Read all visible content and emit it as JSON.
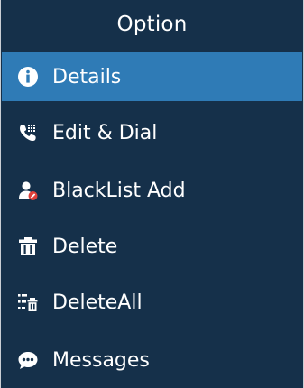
{
  "menu": {
    "title": "Option",
    "items": [
      {
        "label": "Details",
        "icon": "info-icon",
        "selected": true
      },
      {
        "label": "Edit & Dial",
        "icon": "phone-dialpad-icon",
        "selected": false
      },
      {
        "label": "BlackList Add",
        "icon": "user-block-icon",
        "selected": false
      },
      {
        "label": "Delete",
        "icon": "trash-icon",
        "selected": false
      },
      {
        "label": "DeleteAll",
        "icon": "delete-all-icon",
        "selected": false
      },
      {
        "label": "Messages",
        "icon": "chat-bubble-icon",
        "selected": false
      }
    ]
  },
  "colors": {
    "background": "#15304a",
    "selected": "#2f7bb6",
    "text": "#ffffff",
    "accent_red": "#e0403a"
  }
}
